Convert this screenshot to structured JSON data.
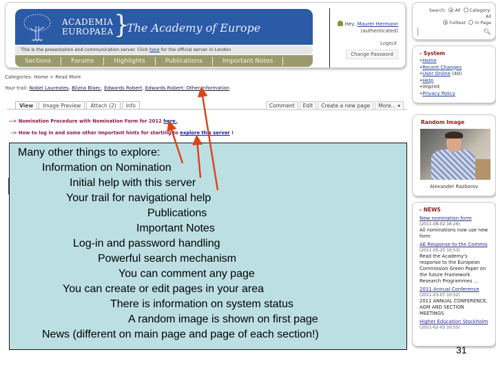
{
  "header": {
    "logo_line1": "ACADEMIA",
    "logo_line2": "EUROPAEA",
    "logo_brace": "}",
    "tagline": "The Academy of Europe",
    "info_text_before": "This is the presentation and communication server. Click ",
    "info_link": "here",
    "info_text_after": " for the official server in London",
    "nav": [
      "Sections",
      "Forums",
      "Highlights",
      "Publications",
      "Important Notes"
    ],
    "user_greeting": "Hey,",
    "user_name": "Maurer Hermann",
    "user_status": "(authenticated)",
    "logout_label": "Logout",
    "change_password_label": "Change Password"
  },
  "search": {
    "label": "Search:",
    "opt_all": "All",
    "opt_category": "Category:",
    "category_value": "All",
    "opt_fulltext": "Fulltext",
    "opt_title": "in Page",
    "search_icon": "magnifier"
  },
  "system": {
    "title": "- System",
    "items": [
      {
        "label": "Home",
        "link": true
      },
      {
        "label": "Recent Changes",
        "link": true
      },
      {
        "label": "User Online",
        "link": true,
        "suffix": " (40)"
      },
      {
        "label": "Help",
        "link": true
      },
      {
        "label": "Imprint",
        "link": false
      },
      {
        "label": "Privacy Policy",
        "link": true
      }
    ]
  },
  "random_image": {
    "title": "Random Image",
    "caption": "Alexander Razborov"
  },
  "news": {
    "title": "- NEWS",
    "items": [
      {
        "title": "New nomination form",
        "date": "(2011-08-02 16:26)",
        "body": "All nominations now use new form"
      },
      {
        "title": "AE Response to the Commis",
        "date": "(2011-05-25 10:53)",
        "body": "Read the Academy's response to the European Commission Green Paper on the future Framework Research Programmes ..."
      },
      {
        "title": "2011 Annual Conference",
        "date": "(2011-03-07 10:52)",
        "body": "2011 ANNUAL CONFERENCE, AGM AND SECTION MEETINGS"
      },
      {
        "title": "Higher Education Stockholm",
        "date": "(2011-02-03 10:55)",
        "body": ""
      }
    ]
  },
  "main": {
    "categories": "Categories: Home > Read More",
    "trail_label": "Your trail:",
    "trail": [
      "Nobel Laureates",
      "Blizna Blaec",
      "Edwards Robert",
      "Edwards Robert: Other Information"
    ],
    "tabs": [
      "View",
      "Image Preview",
      "Attach (2)",
      "Info"
    ],
    "actions": [
      "Comment",
      "Edit",
      "Create a new page",
      "More... ▾"
    ],
    "notice1_text": "--> Nomination Procedure with Nomination Form for 2012 ",
    "notice1_link": "here.",
    "notice2_text": "-> How to log in and some other important hints for starting to ",
    "notice2_link": "explore this server",
    "notice2_after": " !"
  },
  "overlay": {
    "lines": [
      "Many other things to explore:",
      "Information on Nomination",
      "Initial help with this server",
      "Your trail for navigational help",
      "Publications",
      "Important Notes",
      "Log-in and password handling",
      "Powerful search mechanism",
      "You can comment any page",
      "You can create or edit pages in your area",
      "There is information on system status",
      "A random image is shown on first page",
      "News (different on main page and page of  each section!)"
    ],
    "arrow_color": "#d9451a"
  },
  "page_number": "31"
}
